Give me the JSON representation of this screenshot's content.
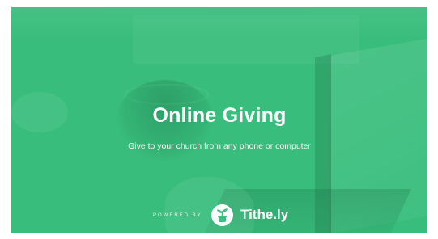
{
  "banner": {
    "title": "Online Giving",
    "subtitle": "Give to your church from any phone or computer",
    "powered_by": "POWERED BY",
    "brand_name": "Tithe.ly",
    "logo_icon": "tithely-plant-icon",
    "background_color": "#3cbf7f"
  }
}
